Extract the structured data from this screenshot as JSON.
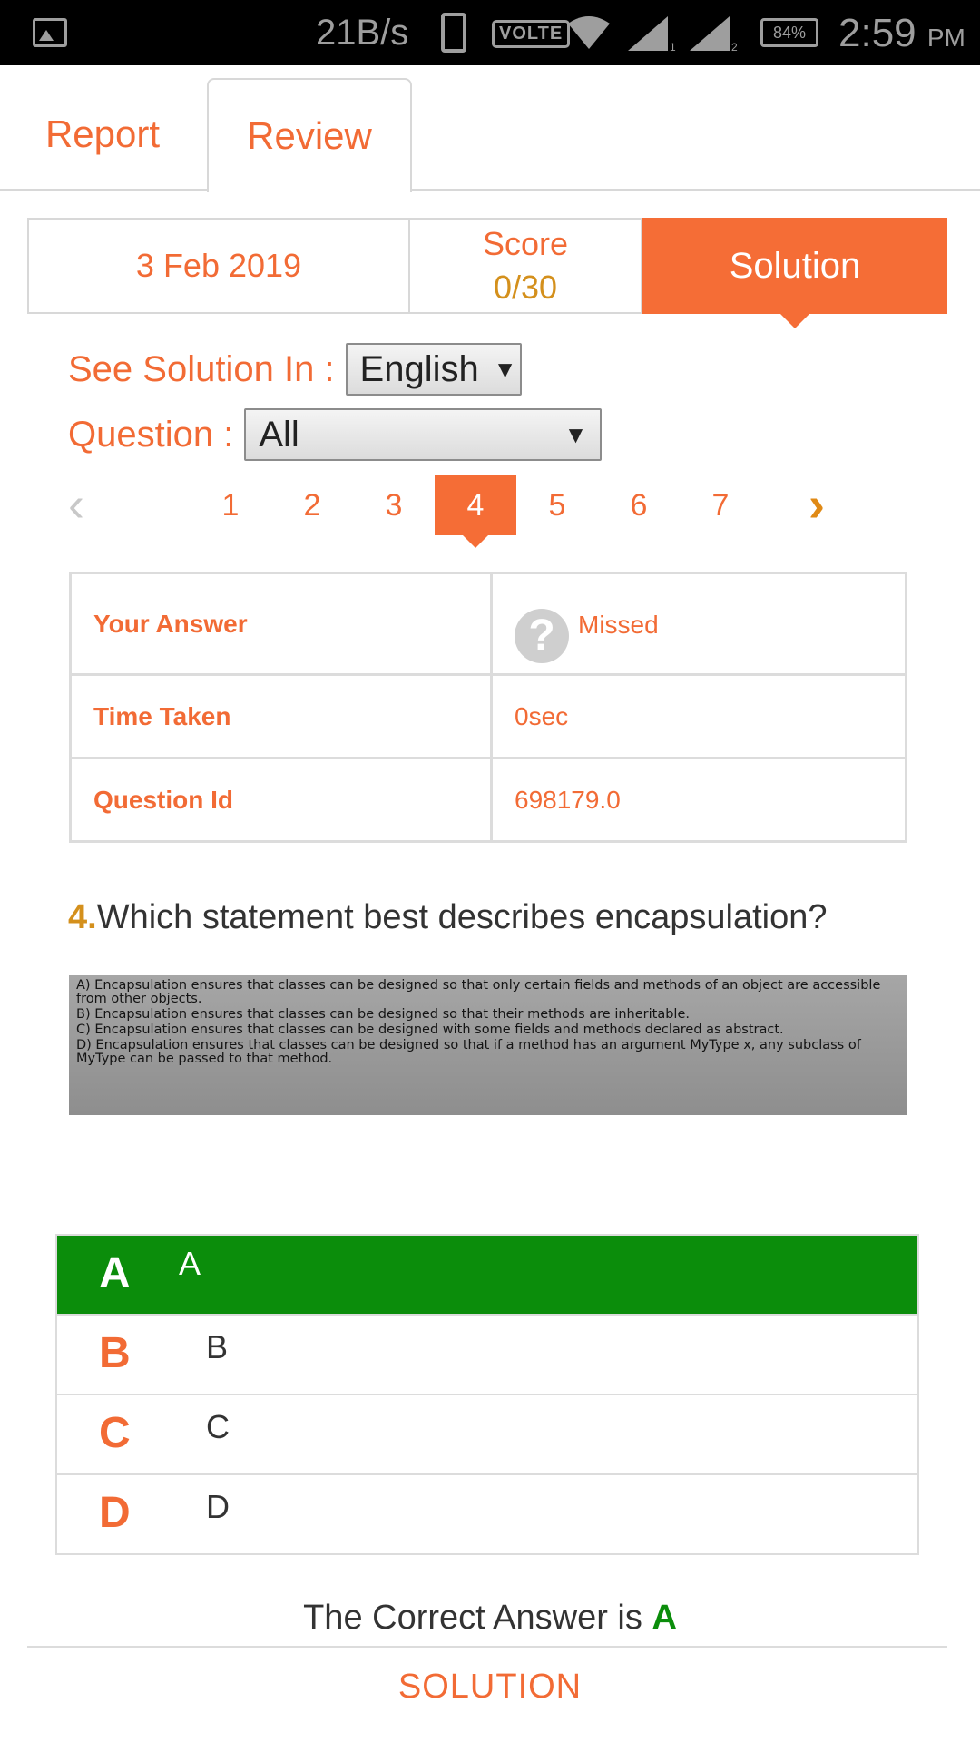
{
  "status_bar": {
    "net_speed": "21B/s",
    "volte": "VOLTE",
    "battery": "84%",
    "time": "2:59",
    "ampm": "PM",
    "sim1": "1",
    "sim2": "2"
  },
  "tabs": {
    "report": "Report",
    "review": "Review"
  },
  "summary": {
    "date": "3 Feb 2019",
    "score_label": "Score",
    "score_value": "0/30",
    "solution": "Solution"
  },
  "filters": {
    "language_label": "See Solution In :",
    "language_value": "English",
    "question_label": "Question :",
    "question_value": "All",
    "arrow": "▼"
  },
  "pager": {
    "prev": "‹",
    "next": "›",
    "pages": [
      "1",
      "2",
      "3",
      "4",
      "5",
      "6",
      "7"
    ],
    "active": "4"
  },
  "info_table": {
    "your_answer_label": "Your Answer",
    "your_answer_value": "Missed",
    "missed_icon": "?",
    "time_taken_label": "Time Taken",
    "time_taken_value": "0sec",
    "question_id_label": "Question Id",
    "question_id_value": "698179.0"
  },
  "question": {
    "number": "4.",
    "text": "Which statement best describes encapsulation?",
    "image_options": [
      "A) Encapsulation ensures that classes can be designed so that only certain fields and methods of an object are accessible from other objects.",
      "B) Encapsulation ensures that classes can be designed so that their methods are inheritable.",
      "C) Encapsulation ensures that classes can be designed with some fields and methods declared as abstract.",
      "D) Encapsulation ensures that classes can be designed so that if a method has an argument MyType x, any subclass of MyType can be passed to that method."
    ]
  },
  "options": [
    {
      "letter": "A",
      "text": "A",
      "correct": true
    },
    {
      "letter": "B",
      "text": "B",
      "correct": false
    },
    {
      "letter": "C",
      "text": "C",
      "correct": false
    },
    {
      "letter": "D",
      "text": "D",
      "correct": false
    }
  ],
  "result": {
    "prefix": "The Correct Answer is",
    "answer": "A"
  },
  "solution_header": "SOLUTION",
  "colors": {
    "accent": "#f56d36",
    "score": "#d4901c",
    "correct": "#0b8d0b"
  }
}
